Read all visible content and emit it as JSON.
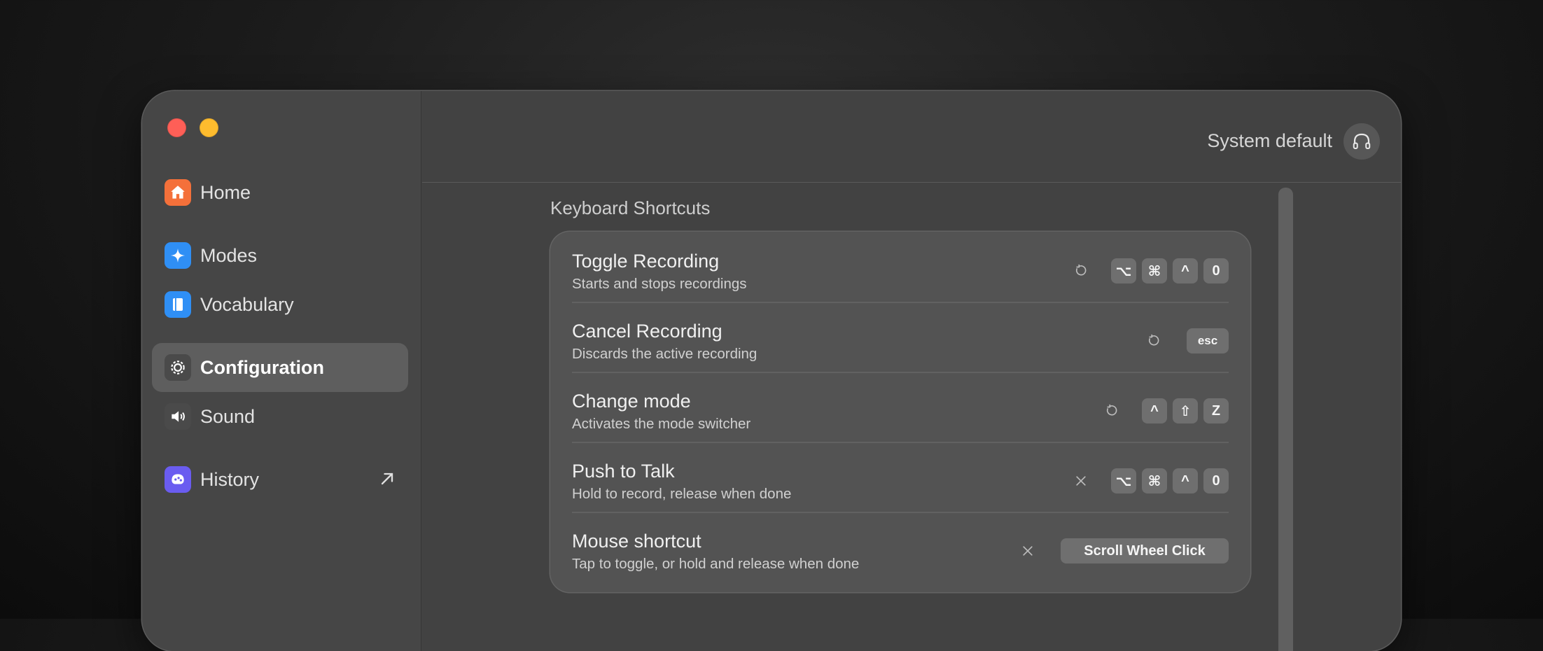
{
  "window": {
    "title": ""
  },
  "sidebar": {
    "items": [
      {
        "label": "Home",
        "icon": "home-icon",
        "color": "#f4703a"
      },
      {
        "label": "Modes",
        "icon": "sparkle-icon",
        "color": "#2f8ff5"
      },
      {
        "label": "Vocabulary",
        "icon": "book-icon",
        "color": "#2f8ff5"
      },
      {
        "label": "Configuration",
        "icon": "gear-icon",
        "color": "#4a4a4a",
        "active": true
      },
      {
        "label": "Sound",
        "icon": "speaker-icon",
        "color": "#4a4a4a"
      },
      {
        "label": "History",
        "icon": "history-icon",
        "color": "#6a5cf0",
        "external": true
      }
    ]
  },
  "header": {
    "device_label": "System default",
    "device_icon": "headphones-icon"
  },
  "shortcuts": {
    "section_title": "Keyboard Shortcuts",
    "rows": [
      {
        "title": "Toggle Recording",
        "desc": "Starts and stops recordings",
        "action_icon": "reset-icon",
        "keys": [
          "⌥",
          "⌘",
          "^",
          "0"
        ]
      },
      {
        "title": "Cancel Recording",
        "desc": "Discards the active recording",
        "action_icon": "reset-icon",
        "keys": [
          "esc"
        ]
      },
      {
        "title": "Change mode",
        "desc": "Activates the mode switcher",
        "action_icon": "reset-icon",
        "keys": [
          "^",
          "⇧",
          "Z"
        ]
      },
      {
        "title": "Push to Talk",
        "desc": "Hold to record, release when done",
        "action_icon": "clear-icon",
        "keys": [
          "⌥",
          "⌘",
          "^",
          "0"
        ]
      },
      {
        "title": "Mouse shortcut",
        "desc": "Tap to toggle, or hold and release when done",
        "action_icon": "clear-icon",
        "keys": [
          "Scroll Wheel Click"
        ]
      }
    ]
  },
  "colors": {
    "window_bg": "#424242",
    "sidebar_bg": "#464646",
    "card_bg": "#535353",
    "key_bg": "#6f6f6f",
    "active_item_bg": "#5e5e5e"
  }
}
